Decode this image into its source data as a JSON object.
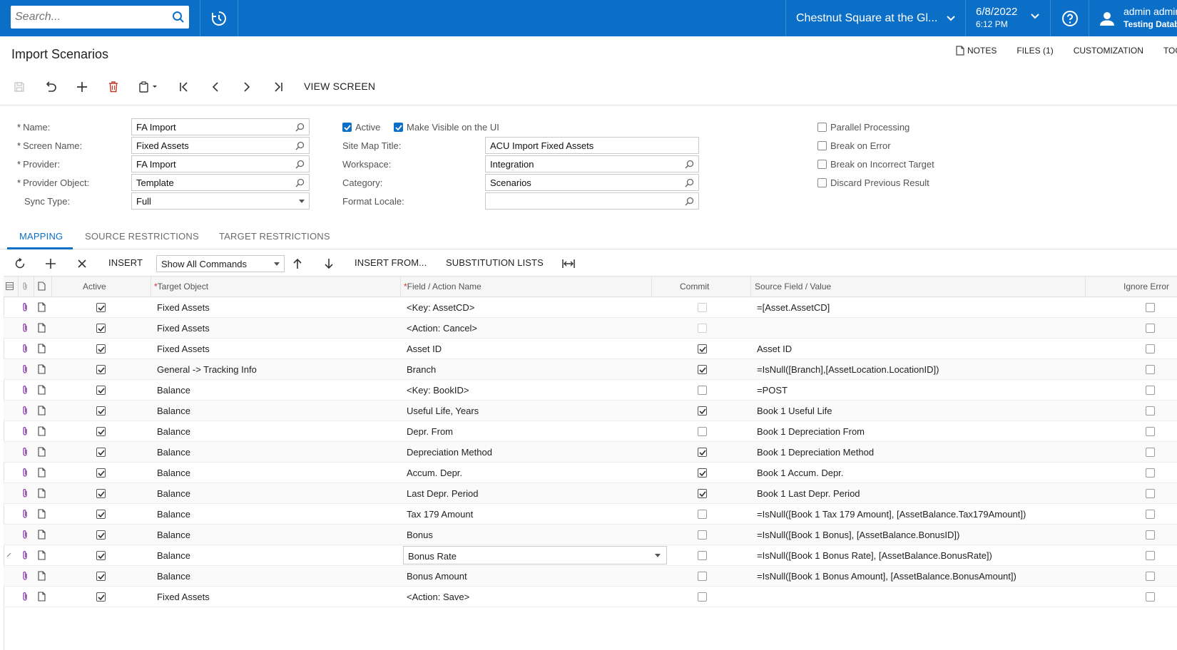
{
  "topbar": {
    "search_placeholder": "Search...",
    "company": "Chestnut Square at the Gl...",
    "date": "6/8/2022",
    "time": "6:12 PM",
    "user_name": "admin admin",
    "database": "Testing Database",
    "accent": "#0b6fc8"
  },
  "page": {
    "title": "Import Scenarios",
    "links": [
      "NOTES",
      "FILES (1)",
      "CUSTOMIZATION",
      "TOOLS"
    ],
    "view_screen": "VIEW SCREEN"
  },
  "form": {
    "name_label": "Name:",
    "name_value": "FA Import",
    "screen_label": "Screen Name:",
    "screen_value": "Fixed Assets",
    "provider_label": "Provider:",
    "provider_value": "FA Import",
    "provider_object_label": "Provider Object:",
    "provider_object_value": "Template",
    "sync_label": "Sync Type:",
    "sync_value": "Full",
    "active_label": "Active",
    "active_checked": true,
    "visible_label": "Make Visible on the UI",
    "visible_checked": true,
    "sitemap_label": "Site Map Title:",
    "sitemap_value": "ACU Import Fixed Assets",
    "workspace_label": "Workspace:",
    "workspace_value": "Integration",
    "category_label": "Category:",
    "category_value": "Scenarios",
    "locale_label": "Format Locale:",
    "locale_value": "",
    "parallel_label": "Parallel Processing",
    "break_error_label": "Break on Error",
    "break_target_label": "Break on Incorrect Target",
    "discard_label": "Discard Previous Result"
  },
  "tabs": [
    "MAPPING",
    "SOURCE RESTRICTIONS",
    "TARGET RESTRICTIONS"
  ],
  "grid_toolbar": {
    "insert": "INSERT",
    "filter": "Show All Commands",
    "insert_from": "INSERT FROM...",
    "substitution": "SUBSTITUTION LISTS"
  },
  "grid": {
    "columns": {
      "active": "Active",
      "target": "Target Object",
      "field": "Field / Action Name",
      "commit": "Commit",
      "source": "Source Field / Value",
      "ignore": "Ignore Error"
    },
    "rows": [
      {
        "target": "Fixed Assets",
        "field": "<Key: AssetCD>",
        "commit": "disabled",
        "source": "=[Asset.AssetCD]"
      },
      {
        "target": "Fixed Assets",
        "field": "<Action: Cancel>",
        "commit": "disabled",
        "source": ""
      },
      {
        "target": "Fixed Assets",
        "field": "Asset ID",
        "commit": "checked",
        "source": "Asset ID"
      },
      {
        "target": "General -> Tracking Info",
        "field": "Branch",
        "commit": "checked",
        "source": "=IsNull([Branch],[AssetLocation.LocationID])"
      },
      {
        "target": "Balance",
        "field": "<Key: BookID>",
        "commit": "unchecked",
        "source": "=POST"
      },
      {
        "target": "Balance",
        "field": "Useful Life, Years",
        "commit": "checked",
        "source": "Book 1 Useful Life"
      },
      {
        "target": "Balance",
        "field": "Depr. From",
        "commit": "unchecked",
        "source": "Book 1 Depreciation From"
      },
      {
        "target": "Balance",
        "field": "Depreciation Method",
        "commit": "checked",
        "source": "Book 1 Depreciation Method"
      },
      {
        "target": "Balance",
        "field": "Accum. Depr.",
        "commit": "checked",
        "source": "Book 1 Accum. Depr."
      },
      {
        "target": "Balance",
        "field": "Last Depr. Period",
        "commit": "checked",
        "source": "Book 1 Last Depr. Period"
      },
      {
        "target": "Balance",
        "field": "Tax 179 Amount",
        "commit": "unchecked",
        "source": "=IsNull([Book 1 Tax 179 Amount], [AssetBalance.Tax179Amount])"
      },
      {
        "target": "Balance",
        "field": "Bonus",
        "commit": "unchecked",
        "source": "=IsNull([Book 1 Bonus], [AssetBalance.BonusID])"
      },
      {
        "target": "Balance",
        "field": "Bonus Rate",
        "commit": "unchecked",
        "source": "=IsNull([Book 1 Bonus Rate], [AssetBalance.BonusRate])",
        "editing": true
      },
      {
        "target": "Balance",
        "field": "Bonus Amount",
        "commit": "unchecked",
        "source": "=IsNull([Book 1 Bonus Amount], [AssetBalance.BonusAmount])"
      },
      {
        "target": "Fixed Assets",
        "field": "<Action: Save>",
        "commit": "unchecked",
        "source": ""
      }
    ]
  }
}
